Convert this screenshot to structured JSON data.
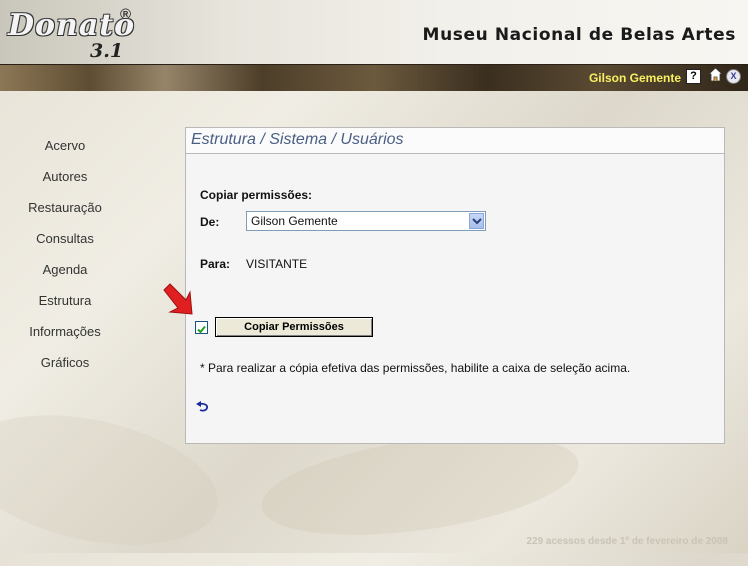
{
  "header": {
    "logo_text": "Donato",
    "logo_registered": "®",
    "logo_version": "3.1",
    "museum_title": "Museu Nacional de Belas Artes"
  },
  "topbar": {
    "user_name": "Gilson Gemente",
    "help_icon": "?",
    "home_icon": "home-icon",
    "close_icon": "X"
  },
  "nav": {
    "items": [
      "Acervo",
      "Autores",
      "Restauração",
      "Consultas",
      "Agenda",
      "Estrutura",
      "Informações",
      "Gráficos"
    ]
  },
  "panel": {
    "breadcrumb": "Estrutura / Sistema / Usuários",
    "section_label": "Copiar permissões:",
    "de_label": "De:",
    "de_value": "Gilson Gemente",
    "para_label": "Para:",
    "para_value": "VISITANTE",
    "checkbox_checked": true,
    "copy_button_label": "Copiar Permissões",
    "note": "* Para realizar a cópia efetiva das permissões, habilite a caixa de seleção acima.",
    "back_icon": "undo-arrow-icon"
  },
  "footer": {
    "text": "229 acessos desde 1º de fevereiro de 2008"
  },
  "colors": {
    "breadcrumb": "#4a5f85",
    "username": "#f8f060",
    "pointer_arrow": "#e02020"
  }
}
